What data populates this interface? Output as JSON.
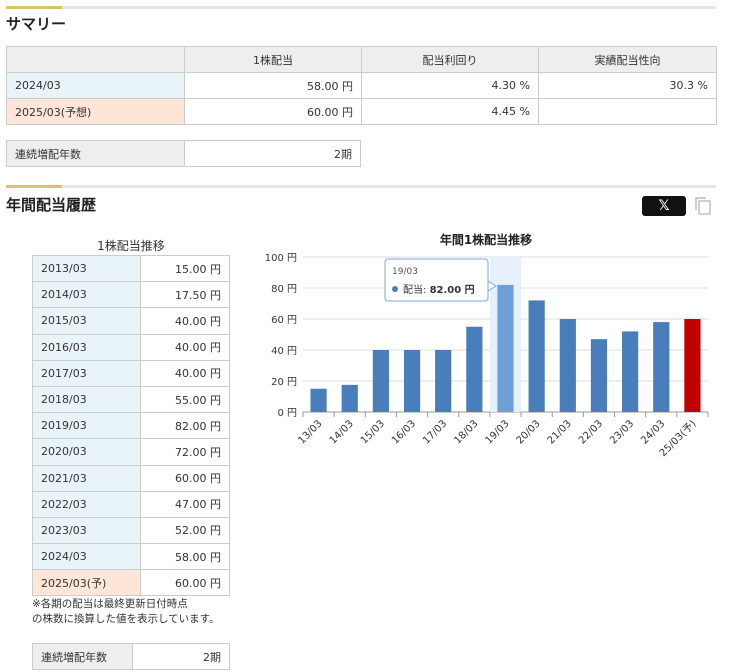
{
  "summary": {
    "title": "サマリー",
    "headers": [
      "",
      "1株配当",
      "配当利回り",
      "実績配当性向"
    ],
    "rows": [
      {
        "period": "2024/03",
        "dividend": "58.00 円",
        "yield": "4.30 %",
        "payout": "30.3 %"
      },
      {
        "period": "2025/03(予想)",
        "dividend": "60.00 円",
        "yield": "4.45 %",
        "payout": ""
      }
    ],
    "streak_label": "連続増配年数",
    "streak_value": "2期"
  },
  "history": {
    "title": "年間配当履歴",
    "table_title": "1株配当推移",
    "rows": [
      {
        "period": "2013/03",
        "value": "15.00 円"
      },
      {
        "period": "2014/03",
        "value": "17.50 円"
      },
      {
        "period": "2015/03",
        "value": "40.00 円"
      },
      {
        "period": "2016/03",
        "value": "40.00 円"
      },
      {
        "period": "2017/03",
        "value": "40.00 円"
      },
      {
        "period": "2018/03",
        "value": "55.00 円"
      },
      {
        "period": "2019/03",
        "value": "82.00 円"
      },
      {
        "period": "2020/03",
        "value": "72.00 円"
      },
      {
        "period": "2021/03",
        "value": "60.00 円"
      },
      {
        "period": "2022/03",
        "value": "47.00 円"
      },
      {
        "period": "2023/03",
        "value": "52.00 円"
      },
      {
        "period": "2024/03",
        "value": "58.00 円"
      },
      {
        "period": "2025/03(予)",
        "value": "60.00 円"
      }
    ],
    "note_line1": "※各期の配当は最終更新日付時点",
    "note_line2": "の株数に換算した値を表示しています。",
    "streak_label": "連続増配年数",
    "streak_value": "2期"
  },
  "share": {
    "x_label": "𝕏",
    "x_icon": "x-logo-icon",
    "copy_icon": "copy-icon"
  },
  "chart_data": {
    "type": "bar",
    "title": "年間1株配当推移",
    "categories": [
      "13/03",
      "14/03",
      "15/03",
      "16/03",
      "17/03",
      "18/03",
      "19/03",
      "20/03",
      "21/03",
      "22/03",
      "23/03",
      "24/03",
      "25/03(予)"
    ],
    "values": [
      15,
      17.5,
      40,
      40,
      40,
      55,
      82,
      72,
      60,
      47,
      52,
      58,
      60
    ],
    "forecast_index": 12,
    "highlight_index": 6,
    "ylim": [
      0,
      100
    ],
    "yticks": [
      "0 円",
      "20 円",
      "40 円",
      "60 円",
      "80 円",
      "100 円"
    ],
    "ytick_values": [
      0,
      20,
      40,
      60,
      80,
      100
    ],
    "grid": true,
    "colors": {
      "bar": "#4a7ebb",
      "forecast": "#c00000",
      "hover": "#6fa0d8"
    },
    "tooltip": {
      "category": "19/03",
      "label": "配当:",
      "value": "82.00 円"
    }
  }
}
